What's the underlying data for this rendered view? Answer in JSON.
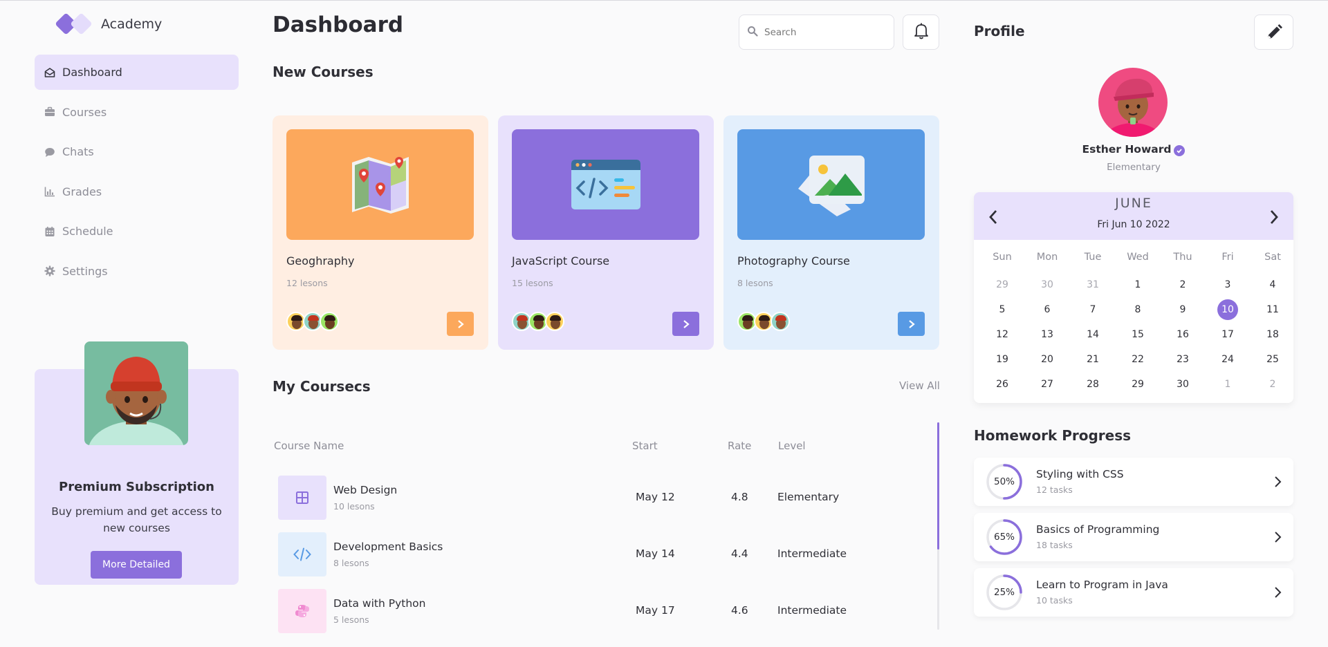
{
  "app": {
    "name": "Academy"
  },
  "sidebar": {
    "items": [
      {
        "label": "Dashboard",
        "icon": "envelope-open-icon",
        "active": true
      },
      {
        "label": "Courses",
        "icon": "briefcase-icon",
        "active": false
      },
      {
        "label": "Chats",
        "icon": "chat-bubble-icon",
        "active": false
      },
      {
        "label": "Grades",
        "icon": "bar-chart-icon",
        "active": false
      },
      {
        "label": "Schedule",
        "icon": "calendar-icon",
        "active": false
      },
      {
        "label": "Settings",
        "icon": "gear-icon",
        "active": false
      }
    ],
    "premium": {
      "title": "Premium Subscription",
      "description": "Buy premium and get access to new courses",
      "button": "More Detailed"
    }
  },
  "header": {
    "title": "Dashboard",
    "search_placeholder": "Search"
  },
  "new_courses": {
    "title": "New Courses",
    "cards": [
      {
        "title": "Geoghraphy",
        "lessons": "12 lesons",
        "bg": "#ffeee2",
        "img_bg": "#fca85c",
        "btn": "#fca85c",
        "icon": "map-icon"
      },
      {
        "title": "JavaScript Course",
        "lessons": "15 lesons",
        "bg": "#e8e1fc",
        "img_bg": "#8b6fdc",
        "btn": "#8b6fdc",
        "icon": "code-window-icon"
      },
      {
        "title": "Photography Course",
        "lessons": "8 lesons",
        "bg": "#e3effc",
        "img_bg": "#589ae4",
        "btn": "#589ae4",
        "icon": "photo-icon"
      }
    ]
  },
  "my_courses": {
    "title": "My Coursecs",
    "view_all": "View All",
    "columns": [
      "Course Name",
      "Start",
      "Rate",
      "Level"
    ],
    "rows": [
      {
        "name": "Web Design",
        "lessons": "10 lesons",
        "start": "May 12",
        "rate": "4.8",
        "level": "Elementary",
        "icon": "grid-icon",
        "icon_bg": "#e8e1fc",
        "icon_color": "#8b6fdc"
      },
      {
        "name": "Development Basics",
        "lessons": "8 lesons",
        "start": "May 14",
        "rate": "4.4",
        "level": "Intermediate",
        "icon": "code-icon",
        "icon_bg": "#e3effc",
        "icon_color": "#589ae4"
      },
      {
        "name": "Data with Python",
        "lessons": "5 lesons",
        "start": "May 17",
        "rate": "4.6",
        "level": "Intermediate",
        "icon": "python-icon",
        "icon_bg": "#fde2f3",
        "icon_color": "#f08ad0"
      }
    ]
  },
  "profile": {
    "title": "Profile",
    "name": "Esther Howard",
    "level": "Elementary"
  },
  "calendar": {
    "month": "JUNE",
    "date": "Fri Jun 10 2022",
    "weekdays": [
      "Sun",
      "Mon",
      "Tue",
      "Wed",
      "Thu",
      "Fri",
      "Sat"
    ],
    "weeks": [
      [
        "29",
        "30",
        "31",
        "1",
        "2",
        "3",
        "4"
      ],
      [
        "5",
        "6",
        "7",
        "8",
        "9",
        "10",
        "11"
      ],
      [
        "12",
        "13",
        "14",
        "15",
        "16",
        "17",
        "18"
      ],
      [
        "19",
        "20",
        "21",
        "22",
        "23",
        "24",
        "25"
      ],
      [
        "26",
        "27",
        "28",
        "29",
        "30",
        "1",
        "2"
      ]
    ],
    "selected": "10"
  },
  "homework": {
    "title": "Homework Progress",
    "items": [
      {
        "name": "Styling with CSS",
        "tasks": "12 tasks",
        "percent": 50,
        "percent_label": "50%"
      },
      {
        "name": "Basics of Programming",
        "tasks": "18 tasks",
        "percent": 65,
        "percent_label": "65%"
      },
      {
        "name": "Learn to Program in Java",
        "tasks": "10 tasks",
        "percent": 25,
        "percent_label": "25%"
      }
    ]
  },
  "colors": {
    "accent": "#8b6fdc",
    "accent_light": "#e8e1fc"
  }
}
